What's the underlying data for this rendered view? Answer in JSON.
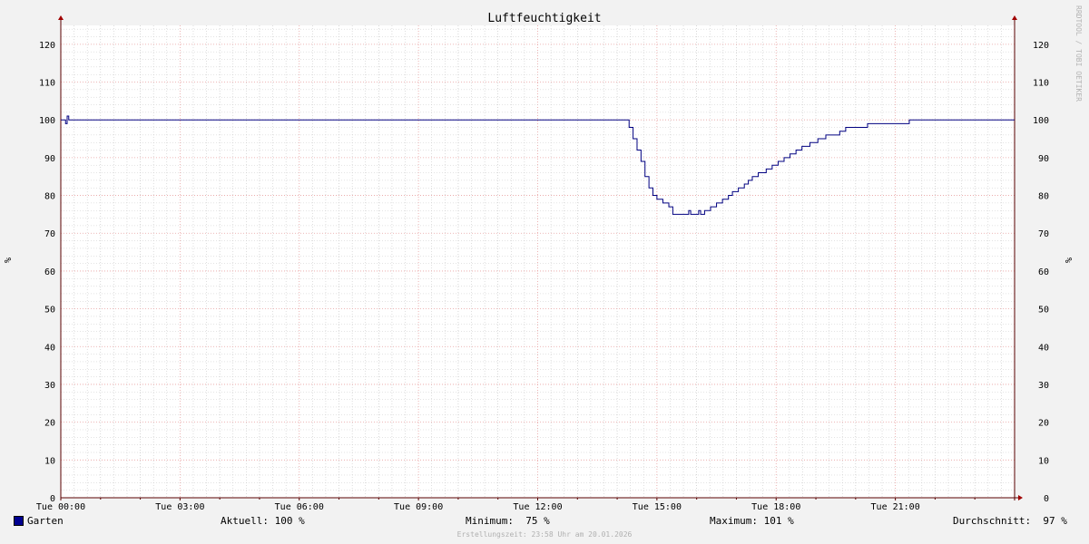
{
  "watermark": "RRDTOOL / TOBI OETIKER",
  "chart_data": {
    "type": "line",
    "title": "Luftfeuchtigkeit",
    "ylabel": "%",
    "ylabel_right": "%",
    "ylim": [
      0,
      125
    ],
    "yticks": [
      0,
      10,
      20,
      30,
      40,
      50,
      60,
      70,
      80,
      90,
      100,
      110,
      120
    ],
    "xlim_hours": [
      0,
      24
    ],
    "xticks": [
      {
        "h": 0,
        "label": "Tue 00:00"
      },
      {
        "h": 3,
        "label": "Tue 03:00"
      },
      {
        "h": 6,
        "label": "Tue 06:00"
      },
      {
        "h": 9,
        "label": "Tue 09:00"
      },
      {
        "h": 12,
        "label": "Tue 12:00"
      },
      {
        "h": 15,
        "label": "Tue 15:00"
      },
      {
        "h": 18,
        "label": "Tue 18:00"
      },
      {
        "h": 21,
        "label": "Tue 21:00"
      }
    ],
    "grid": true,
    "legend_placement": "bottom",
    "colors": {
      "line": "#000080",
      "minor_grid": "#c8c8c8",
      "major_grid": "#e8a0a0",
      "axis": "#5a0000",
      "plot_bg": "#ffffff"
    },
    "series": [
      {
        "name": "Garten",
        "color": "#000080",
        "points": [
          [
            0.0,
            100
          ],
          [
            0.08,
            100
          ],
          [
            0.12,
            99
          ],
          [
            0.16,
            101
          ],
          [
            0.2,
            100
          ],
          [
            14.2,
            100
          ],
          [
            14.3,
            98
          ],
          [
            14.4,
            95
          ],
          [
            14.5,
            92
          ],
          [
            14.6,
            89
          ],
          [
            14.7,
            85
          ],
          [
            14.8,
            82
          ],
          [
            14.9,
            80
          ],
          [
            15.0,
            79
          ],
          [
            15.15,
            78
          ],
          [
            15.3,
            77
          ],
          [
            15.4,
            75
          ],
          [
            15.55,
            75
          ],
          [
            15.75,
            75
          ],
          [
            15.8,
            76
          ],
          [
            15.85,
            75
          ],
          [
            16.0,
            75
          ],
          [
            16.05,
            76
          ],
          [
            16.1,
            75
          ],
          [
            16.2,
            76
          ],
          [
            16.35,
            77
          ],
          [
            16.5,
            78
          ],
          [
            16.65,
            79
          ],
          [
            16.8,
            80
          ],
          [
            16.9,
            81
          ],
          [
            17.05,
            82
          ],
          [
            17.2,
            83
          ],
          [
            17.3,
            84
          ],
          [
            17.4,
            85
          ],
          [
            17.55,
            86
          ],
          [
            17.75,
            87
          ],
          [
            17.9,
            88
          ],
          [
            18.05,
            89
          ],
          [
            18.2,
            90
          ],
          [
            18.35,
            91
          ],
          [
            18.5,
            92
          ],
          [
            18.65,
            93
          ],
          [
            18.85,
            94
          ],
          [
            19.05,
            95
          ],
          [
            19.25,
            96
          ],
          [
            19.6,
            97
          ],
          [
            19.75,
            98
          ],
          [
            20.2,
            98
          ],
          [
            20.3,
            99
          ],
          [
            21.2,
            99
          ],
          [
            21.35,
            100
          ],
          [
            24.0,
            100
          ]
        ]
      }
    ]
  },
  "legend": {
    "swatch_color": "#000090",
    "series_label": "Garten",
    "current": "Aktuell: 100 %",
    "minimum": "Minimum:  75 %",
    "maximum": "Maximum: 101 %",
    "average": "Durchschnitt:  97 %"
  },
  "footer": "Erstellungszeit: 23:58 Uhr am 20.01.2026"
}
